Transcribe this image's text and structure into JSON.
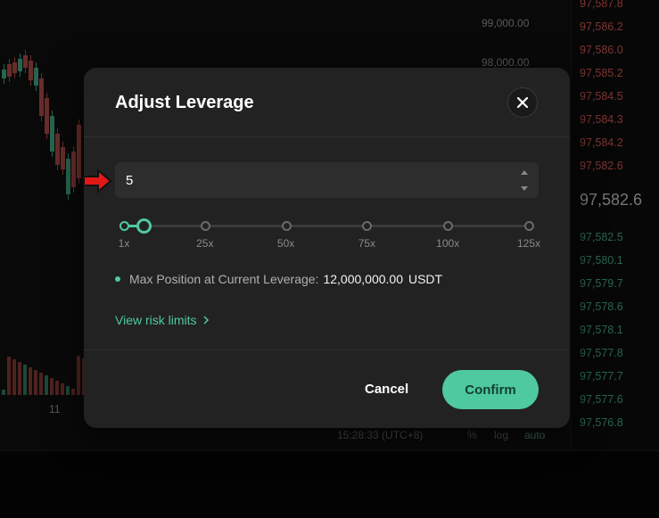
{
  "background": {
    "axis_prices": [
      "99,000.00",
      "98,000.00"
    ],
    "x_label": "11",
    "orderbook_top": [
      "97,587.8",
      "97,586.2",
      "97,586.0",
      "97,585.2",
      "97,584.5",
      "97,584.3",
      "97,584.2",
      "97,582.6"
    ],
    "mid_price": "97,582.6",
    "orderbook_bottom": [
      "97,582.5",
      "97,580.1",
      "97,579.7",
      "97,578.6",
      "97,578.1",
      "97,577.8",
      "97,577.7",
      "97,577.6",
      "97,576.8"
    ],
    "time": "15:28:33 (UTC+8)",
    "pct_label": "%",
    "log_label": "log",
    "auto_label": "auto"
  },
  "modal": {
    "title": "Adjust Leverage",
    "leverage_value": "5",
    "slider": {
      "value": 5,
      "max": 125,
      "ticks": [
        "1x",
        "25x",
        "50x",
        "75x",
        "100x",
        "125x"
      ]
    },
    "max_position_label": "Max Position at Current Leverage:",
    "max_position_value": "12,000,000.00",
    "max_position_unit": "USDT",
    "risk_link": "View risk limits",
    "cancel_label": "Cancel",
    "confirm_label": "Confirm"
  },
  "colors": {
    "accent": "#4fc9a0",
    "ask": "#c0504a",
    "bid": "#3e9a78",
    "arrow": "#e01818"
  },
  "icons": [
    "close-icon",
    "chevron-up-icon",
    "chevron-down-icon",
    "chevron-right-icon",
    "arrow-pointer-icon"
  ]
}
